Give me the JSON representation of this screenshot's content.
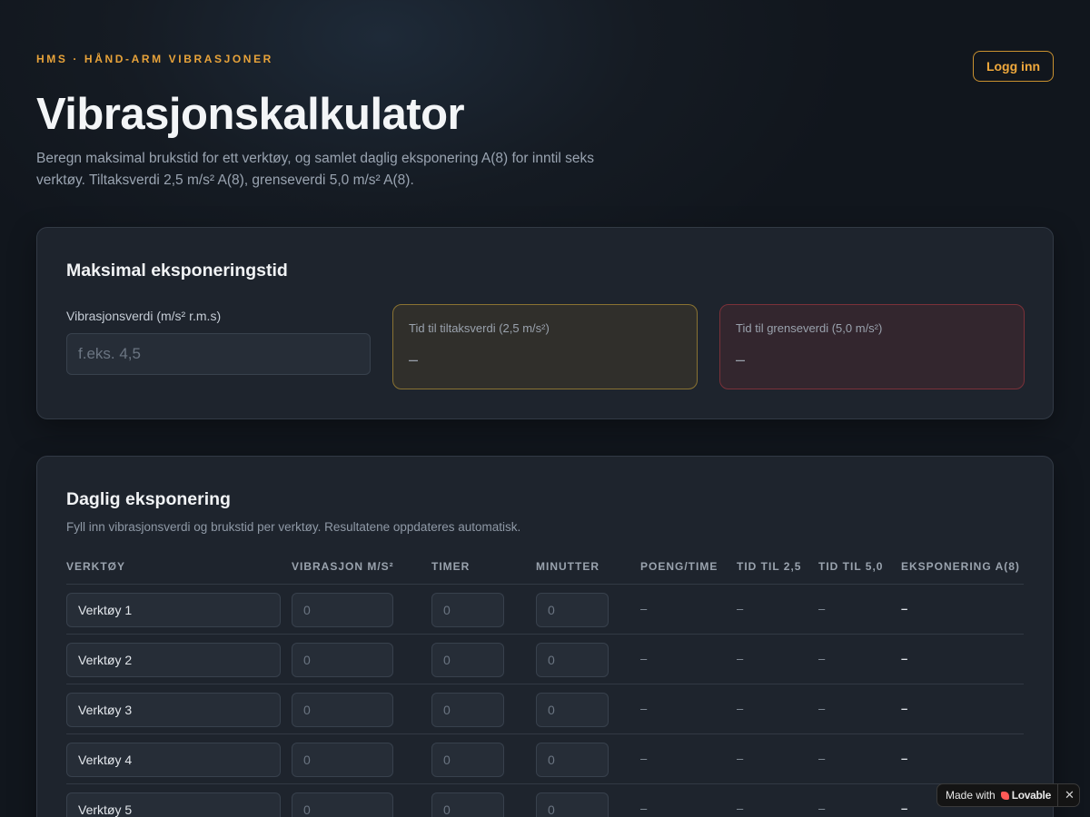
{
  "header": {
    "eyebrow": "HMS · HÅND-ARM VIBRASJONER",
    "login_label": "Logg inn",
    "title": "Vibrasjonskalkulator",
    "intro_line1": "Beregn maksimal brukstid for ett verktøy, og samlet daglig eksponering A(8) for inntil seks",
    "intro_line2": "verktøy. Tiltaksverdi 2,5 m/s² A(8), grenseverdi 5,0 m/s² A(8)."
  },
  "max_exposure": {
    "title": "Maksimal eksponeringstid",
    "input_label": "Vibrasjonsverdi (m/s² r.m.s)",
    "input_placeholder": "f.eks. 4,5",
    "action_label": "Tid til tiltaksverdi (2,5 m/s²)",
    "action_value": "–",
    "limit_label": "Tid til grenseverdi (5,0 m/s²)",
    "limit_value": "–"
  },
  "daily": {
    "title": "Daglig eksponering",
    "subtitle": "Fyll inn vibrasjonsverdi og brukstid per verktøy. Resultatene oppdateres automatisk.",
    "columns": [
      "Verktøy",
      "Vibrasjon m/s²",
      "Timer",
      "Minutter",
      "Poeng/time",
      "Tid til 2,5",
      "Tid til 5,0",
      "Eksponering A(8)"
    ],
    "placeholder": "0",
    "rows": [
      {
        "name": "Verktøy 1",
        "points": "–",
        "t25": "–",
        "t50": "–",
        "a8": "–"
      },
      {
        "name": "Verktøy 2",
        "points": "–",
        "t25": "–",
        "t50": "–",
        "a8": "–"
      },
      {
        "name": "Verktøy 3",
        "points": "–",
        "t25": "–",
        "t50": "–",
        "a8": "–"
      },
      {
        "name": "Verktøy 4",
        "points": "–",
        "t25": "–",
        "t50": "–",
        "a8": "–"
      },
      {
        "name": "Verktøy 5",
        "points": "–",
        "t25": "–",
        "t50": "–",
        "a8": "–"
      }
    ]
  },
  "badge": {
    "made_with": "Made with",
    "brand": "Lovable",
    "close": "✕"
  },
  "colors": {
    "accent": "#e8a33a",
    "action_border": "#8a7332",
    "limit_border": "#7b3139"
  }
}
